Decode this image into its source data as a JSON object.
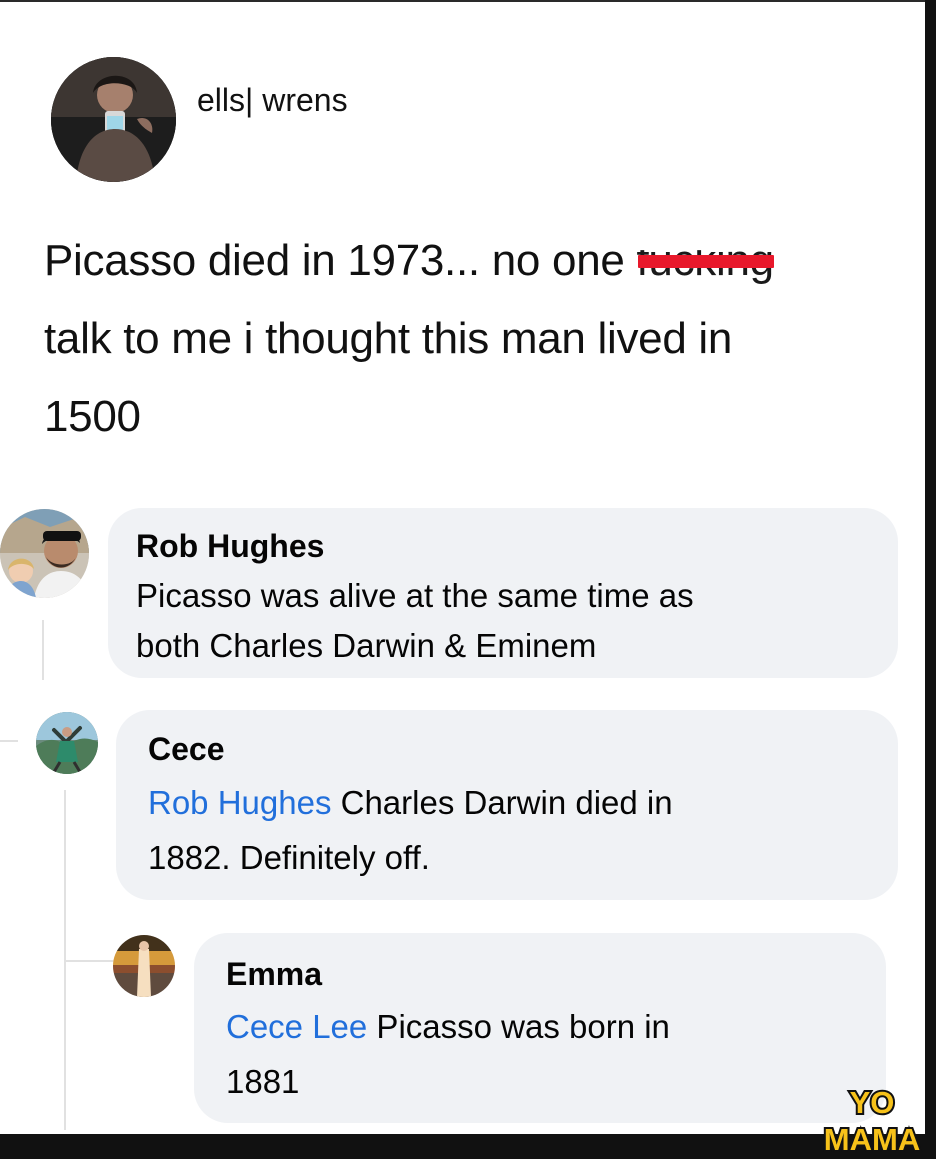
{
  "post": {
    "username": "ells| wrens",
    "text_line_1_a": "Picasso died in 1973... no one ",
    "text_line_1_censored": "fucking",
    "text_line_2": "talk to me i thought this man lived in",
    "text_line_3": "1500"
  },
  "comments": [
    {
      "name": "Rob Hughes",
      "line_1": "Picasso was alive at the same time as",
      "line_2": "both Charles Darwin & Eminem"
    },
    {
      "name": "Cece",
      "mention": "Rob Hughes",
      "line_1_rest": " Charles Darwin died in",
      "line_2": "1882. Definitely off."
    },
    {
      "name": "Emma",
      "mention": "Cece Lee",
      "line_1_rest": " Picasso was born in",
      "line_2": "1881"
    }
  ],
  "watermark": {
    "line_1": "YO",
    "line_2": "MAMA"
  },
  "colors": {
    "bubble": "#f0f2f5",
    "mention": "#216fdb",
    "censor_bar": "#e8182b",
    "watermark_fill": "#f7c21a"
  }
}
